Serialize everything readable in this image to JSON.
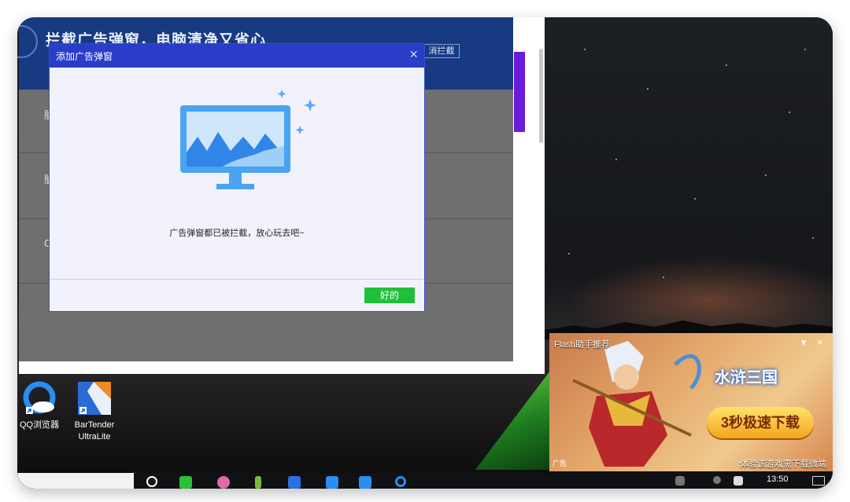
{
  "app_window": {
    "header_title": "拦截广告弹窗，电脑清净又省心",
    "header_button": "消拦截",
    "row_chars": [
      "脏",
      "脏",
      "C"
    ]
  },
  "dialog": {
    "title": "添加广告弹窗",
    "close_glyph": "×",
    "message": "广告弹窗都已被拦截，放心玩去吧~",
    "ok_label": "好的"
  },
  "desktop_icons": [
    {
      "label_line1": "QQ浏览器",
      "label_line2": ""
    },
    {
      "label_line1": "BarTender",
      "label_line2": "UltraLite"
    }
  ],
  "ad_popup": {
    "header": "Flash助手推荐",
    "game_logo": "水浒三国",
    "download_button": "3秒极速下载",
    "tag": "广告",
    "footer": "体验该游戏需下载微端",
    "ctrl_down": "▾",
    "ctrl_close": "×"
  },
  "taskbar": {
    "clock": "13:50"
  },
  "colors": {
    "dialog_titlebar": "#2a3dc9",
    "ok_button": "#1fbf3c",
    "app_header": "#173a83"
  }
}
